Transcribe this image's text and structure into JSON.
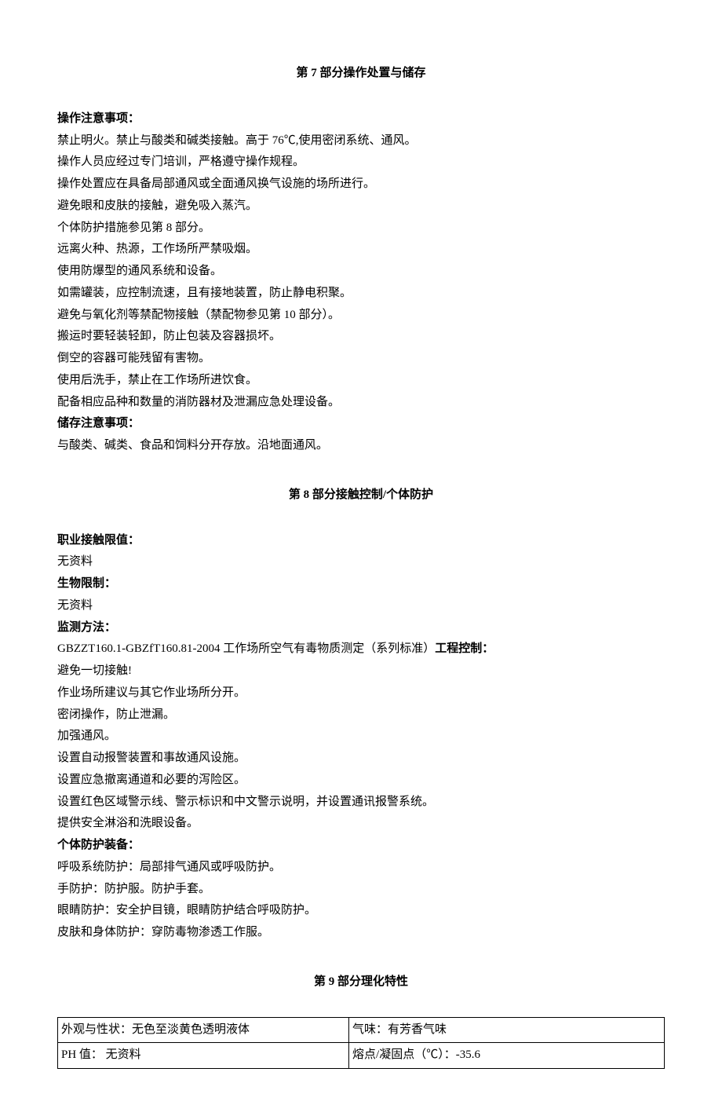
{
  "section7": {
    "title": "第 7 部分操作处置与储存",
    "h1": "操作注意事项：",
    "p1": "禁止明火。禁止与酸类和碱类接触。高于 76℃,使用密闭系统、通风。",
    "p2": "操作人员应经过专门培训，严格遵守操作规程。",
    "p3": "操作处置应在具备局部通风或全面通风换气设施的场所进行。",
    "p4": "避免眼和皮肤的接触，避免吸入蒸汽。",
    "p5": "个体防护措施参见第 8 部分。",
    "p6": "远离火种、热源，工作场所严禁吸烟。",
    "p7": "使用防爆型的通风系统和设备。",
    "p8": "如需罐装，应控制流速，且有接地装置，防止静电积聚。",
    "p9": "避免与氧化剂等禁配物接触（禁配物参见第 10 部分）。",
    "p10": "搬运时要轻装轻卸，防止包装及容器损坏。",
    "p11": "倒空的容器可能残留有害物。",
    "p12": "使用后洗手，禁止在工作场所进饮食。",
    "p13": "配备相应品种和数量的消防器材及泄漏应急处理设备。",
    "h2": "储存注意事项：",
    "p14": "与酸类、碱类、食品和饲料分开存放。沿地面通风。"
  },
  "section8": {
    "title": "第 8 部分接触控制/个体防护",
    "h1": "职业接触限值：",
    "p1": "无资料",
    "h2": "生物限制：",
    "p2": "无资料",
    "h3": "监测方法：",
    "p3a": "GBZZT160.1-GBZfT160.81-2004 工作场所空气有毒物质测定（系列标准）",
    "p3b": "工程控制：",
    "p4": "避免一切接触!",
    "p5": "作业场所建议与其它作业场所分开。",
    "p6": "密闭操作，防止泄漏。",
    "p7": "加强通风。",
    "p8": "设置自动报警装置和事故通风设施。",
    "p9": "设置应急撤离通道和必要的泻险区。",
    "p10": "设置红色区域警示线、警示标识和中文警示说明，并设置通讯报警系统。",
    "p11": "提供安全淋浴和洗眼设备。",
    "h4": "个体防护装备：",
    "p12": "呼吸系统防护：局部排气通风或呼吸防护。",
    "p13": "手防护：防护服。防护手套。",
    "p14": "眼睛防护：安全护目镜，眼睛防护结合呼吸防护。",
    "p15": "皮肤和身体防护：穿防毒物渗透工作服。"
  },
  "section9": {
    "title": "第 9 部分理化特性",
    "table": {
      "r1c1": "外观与性状：无色至淡黄色透明液体",
      "r1c2": "气味：有芳香气味",
      "r2c1": "PH 值： 无资料",
      "r2c2": "熔点/凝固点（℃）：-35.6"
    }
  }
}
